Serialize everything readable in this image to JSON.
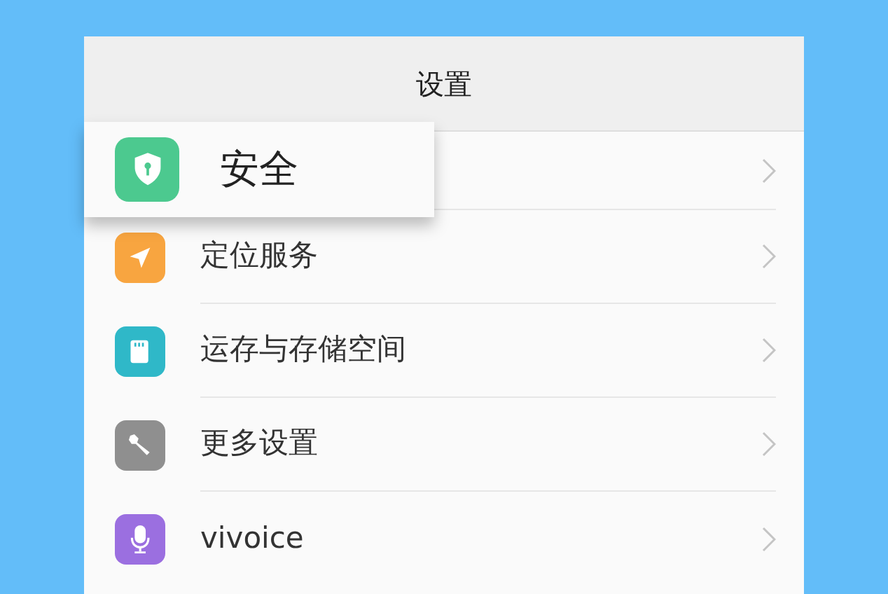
{
  "header": {
    "title": "设置"
  },
  "popup": {
    "label": "安全",
    "kind": "shield",
    "color": "#4cc98f"
  },
  "rows": [
    {
      "kind": "blank"
    },
    {
      "kind": "location",
      "label": "定位服务",
      "color": "#f8a540"
    },
    {
      "kind": "storage",
      "label": "运存与存储空间",
      "color": "#2fb8c8"
    },
    {
      "kind": "wrench",
      "label": "更多设置",
      "color": "#8f8f8f"
    },
    {
      "kind": "mic",
      "label": "vivoice",
      "color": "#9b6fe0"
    }
  ]
}
